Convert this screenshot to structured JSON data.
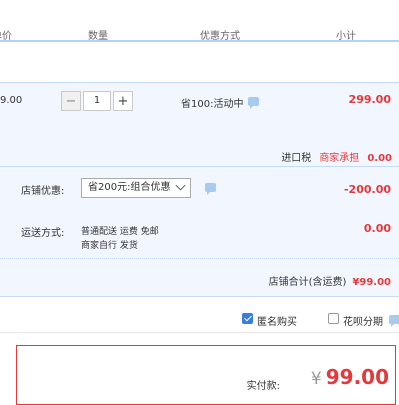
{
  "header": {
    "col_price_partial": "单价",
    "col_qty": "数量",
    "col_discount": "优惠方式",
    "col_subtotal": "小计"
  },
  "item": {
    "unit_price_partial": "9.00",
    "quantity": "1",
    "promo_text": "省100:活动中",
    "subtotal": "299.00"
  },
  "tax": {
    "label": "进口税",
    "bearer": "商家承担",
    "value": "0.00"
  },
  "store": {
    "coupon_label": "店铺优惠:",
    "coupon_selected": "省200元:组合优惠",
    "discount_value": "-200.00",
    "shipping_label": "运送方式:",
    "shipping_line1": "普通配送 运费 免邮",
    "shipping_line2": "商家自行  发货",
    "shipping_fee": "0.00",
    "total_label": "店铺合计(含运费)",
    "total_value": "¥99.00"
  },
  "options": {
    "anonymous_label": "匿名购买",
    "anonymous_checked": true,
    "huabei_label": "花呗分期",
    "huabei_checked": false
  },
  "payment": {
    "label": "实付款:",
    "currency": "¥",
    "amount": "99.00"
  },
  "colors": {
    "accent_red": "#e4393c",
    "band_blue": "#f2f7ff",
    "checkbox_blue": "#3b7ddd"
  }
}
